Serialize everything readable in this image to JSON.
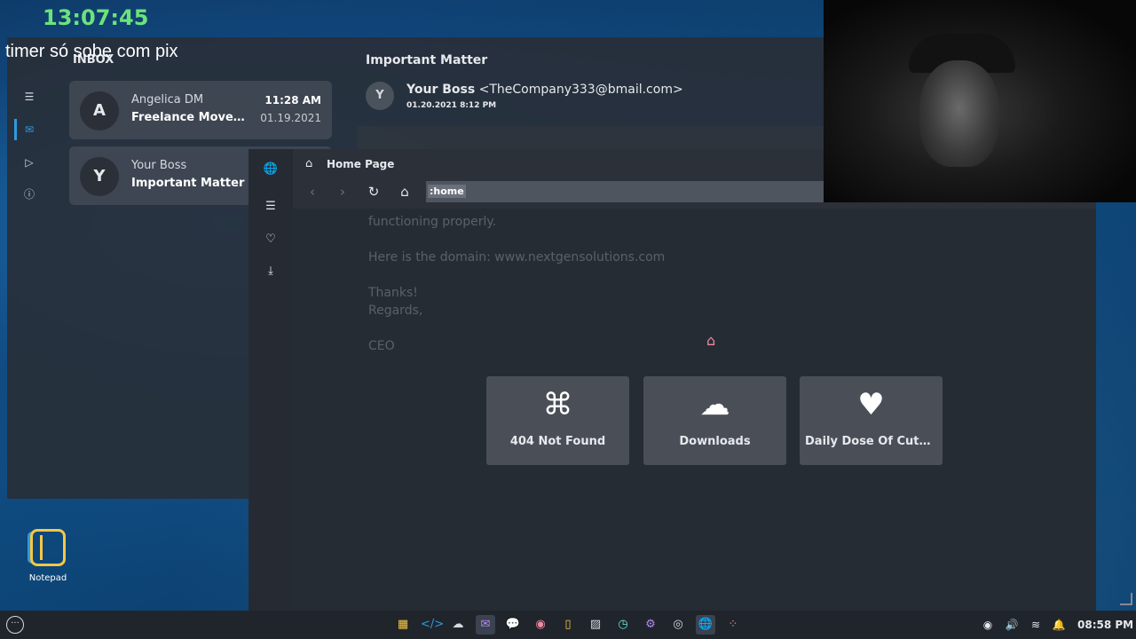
{
  "overlay": {
    "clock": "13:07:45",
    "caption": "timer só sobe com pix"
  },
  "desktop": {
    "notepad_label": "Notepad"
  },
  "mail": {
    "inbox_label": "INBOX",
    "messages": [
      {
        "avatar": "A",
        "from": "Angelica DM",
        "subject": "Freelance Moveme...",
        "time": "11:28 AM",
        "date": "01.19.2021"
      },
      {
        "avatar": "Y",
        "from": "Your Boss",
        "subject": "Important Matter",
        "time": "",
        "date": ""
      }
    ],
    "reader": {
      "title": "Important Matter",
      "avatar": "Y",
      "sender_name": "Your Boss",
      "sender_email": "<TheCompany333@bmail.com>",
      "date": "01.20.2021  8:12 PM",
      "body_lines": [
        "functioning properly.",
        "Here is the domain: www.nextgensolutions.com",
        "Thanks!",
        "Regards,",
        "CEO"
      ]
    }
  },
  "browser": {
    "tab_title": "Home Page",
    "address": ":home",
    "tiles": [
      {
        "icon": "command-icon",
        "label": "404 Not Found"
      },
      {
        "icon": "cloud-download-icon",
        "label": "Downloads"
      },
      {
        "icon": "heart-icon",
        "label": "Daily Dose Of Cuten..."
      }
    ]
  },
  "taskbar": {
    "clock": "08:58 PM",
    "apps": [
      "calculator",
      "code-editor",
      "downloads",
      "mail",
      "messenger",
      "music-player",
      "notepad",
      "gallery",
      "clock",
      "settings",
      "video-player",
      "web-browser",
      "widget-library"
    ],
    "active_app": "web-browser",
    "tray": [
      "record-icon",
      "volume-icon",
      "wifi-icon",
      "bell-icon"
    ]
  },
  "colors": {
    "accent": "#2e9adf",
    "clock_green": "#6ce37a",
    "home_icon_pink": "#f08aa0"
  }
}
